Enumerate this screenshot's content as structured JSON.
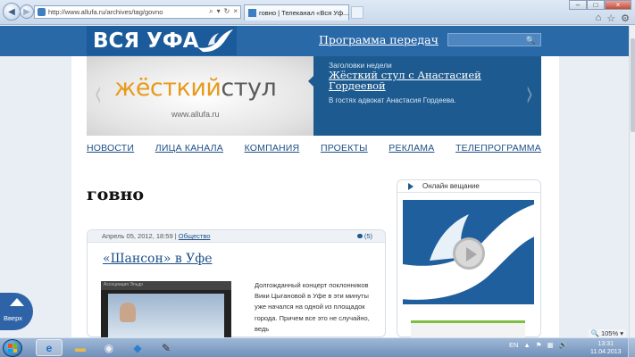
{
  "browser": {
    "url": "http://www.allufa.ru/archives/tag/govno",
    "tab_title": "говно | Телеканал «Вся Уф...",
    "tab_close": "×",
    "back": "◀",
    "forward": "▶",
    "addr_tools": [
      "⌕",
      "▾",
      "↻",
      "×"
    ],
    "window_controls": [
      "–",
      "□",
      "×"
    ],
    "tools_icons": [
      "⌂",
      "☆",
      "⚙"
    ]
  },
  "site": {
    "logo": "ВСЯ УФА",
    "program_link": "Программа передач",
    "search_placeholder": "",
    "search_icon": "🔍"
  },
  "banner": {
    "title_part1": "жёсткий",
    "title_part2": "стул",
    "url": "www.allufa.ru",
    "headlines_label": "Заголовки недели",
    "headline_title": "Жёсткий стул с Анастасией Гордеевой",
    "headline_desc": "В гостях адвокат Анастасия Гордеева.",
    "prev": "‹",
    "next": "›"
  },
  "nav": {
    "items": [
      "НОВОСТИ",
      "ЛИЦА КАНАЛА",
      "КОМПАНИЯ",
      "ПРОЕКТЫ",
      "РЕКЛАМА",
      "ТЕЛЕПРОГРАММА"
    ]
  },
  "page": {
    "title": "говно"
  },
  "post": {
    "date": "Апрель 05, 2012, 18:59 |",
    "category": "Общество",
    "comments": "(5)",
    "title": "«Шансон» в Уфе",
    "excerpt": "Долгожданный концерт поклонников Вики Цыгановой в Уфе в эти минуты уже начался на одной из площадок города. Причем все это не случайно, ведь",
    "thumb_caption": "Ассоциация Эльдо"
  },
  "sidebar": {
    "live_label": "Онлайн вещание"
  },
  "up_button": {
    "label": "Вверх"
  },
  "statusbar": {
    "zoom": "🔍 105% ▾"
  },
  "taskbar": {
    "lang": "EN",
    "tray_icons": [
      "▲",
      "⚑",
      "▦",
      "🔊"
    ],
    "time": "13:31",
    "date": "11.04.2013",
    "apps": [
      "e",
      "▬",
      "◉",
      "◆",
      "✎"
    ]
  },
  "colors": {
    "header_blue": "#2a69a8",
    "link_blue": "#1d4f86",
    "banner_orange": "#e79a1c"
  }
}
